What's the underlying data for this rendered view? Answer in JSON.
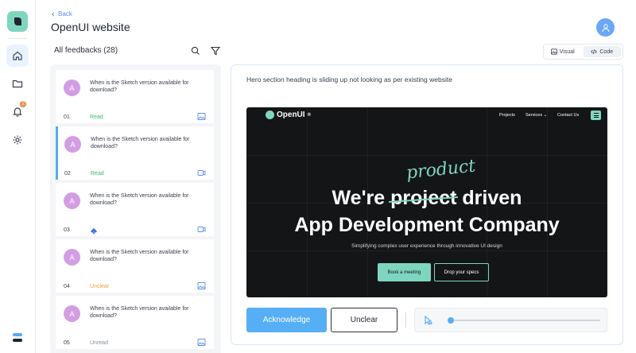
{
  "header": {
    "back_label": "Back",
    "title": "OpenUI website"
  },
  "list": {
    "heading": "All feedbacks (28)",
    "items": [
      {
        "avatar": "A",
        "text": "When is the Sketch version available for download?",
        "number": "01",
        "status": "Read",
        "status_color": "#3cba6b",
        "media": "image-icon",
        "selected": false,
        "source": ""
      },
      {
        "avatar": "A",
        "text": "When is the Sketch version available for download?",
        "number": "02",
        "status": "Read",
        "status_color": "#3cba6b",
        "media": "video-icon",
        "selected": true,
        "source": ""
      },
      {
        "avatar": "A",
        "text": "When is the Sketch version available for download?",
        "number": "03",
        "status": "",
        "status_color": "#3a3f4c",
        "media": "video-icon",
        "selected": false,
        "source": "jira-icon"
      },
      {
        "avatar": "A",
        "text": "When is the Sketch version available for download?",
        "number": "04",
        "status": "Unclear",
        "status_color": "#f0a23a",
        "media": "image-icon",
        "selected": false,
        "source": ""
      },
      {
        "avatar": "A",
        "text": "When is the Sketch version available for download?",
        "number": "05",
        "status": "Unread",
        "status_color": "#8a8f9a",
        "media": "image-icon",
        "selected": false,
        "source": ""
      }
    ]
  },
  "view_toggle": {
    "visual_label": "Visual",
    "code_label": "Code",
    "active": "code"
  },
  "detail": {
    "description": "Hero section heading is sliding up not looking as per existing website",
    "preview": {
      "brand": "OpenUI",
      "brand_mark": "®",
      "nav": [
        "Projects",
        "Services",
        "Contact Us"
      ],
      "handwritten": "product",
      "line1_before": "We're ",
      "line1_strike": "project",
      "line1_after": " driven",
      "line2": "App Development Company",
      "subtitle": "Simplifying complex user experience through innovative UI design",
      "cta_primary": "Book a meeting",
      "cta_secondary": "Drop your specs"
    },
    "acknowledge_label": "Acknowledge",
    "unclear_label": "Unclear",
    "playback_progress": 0.02
  },
  "nav_rail": {
    "notification_count": "2"
  },
  "colors": {
    "accent": "#56aef5",
    "brand": "#7fd6bf",
    "avatar": "#d39de3"
  }
}
